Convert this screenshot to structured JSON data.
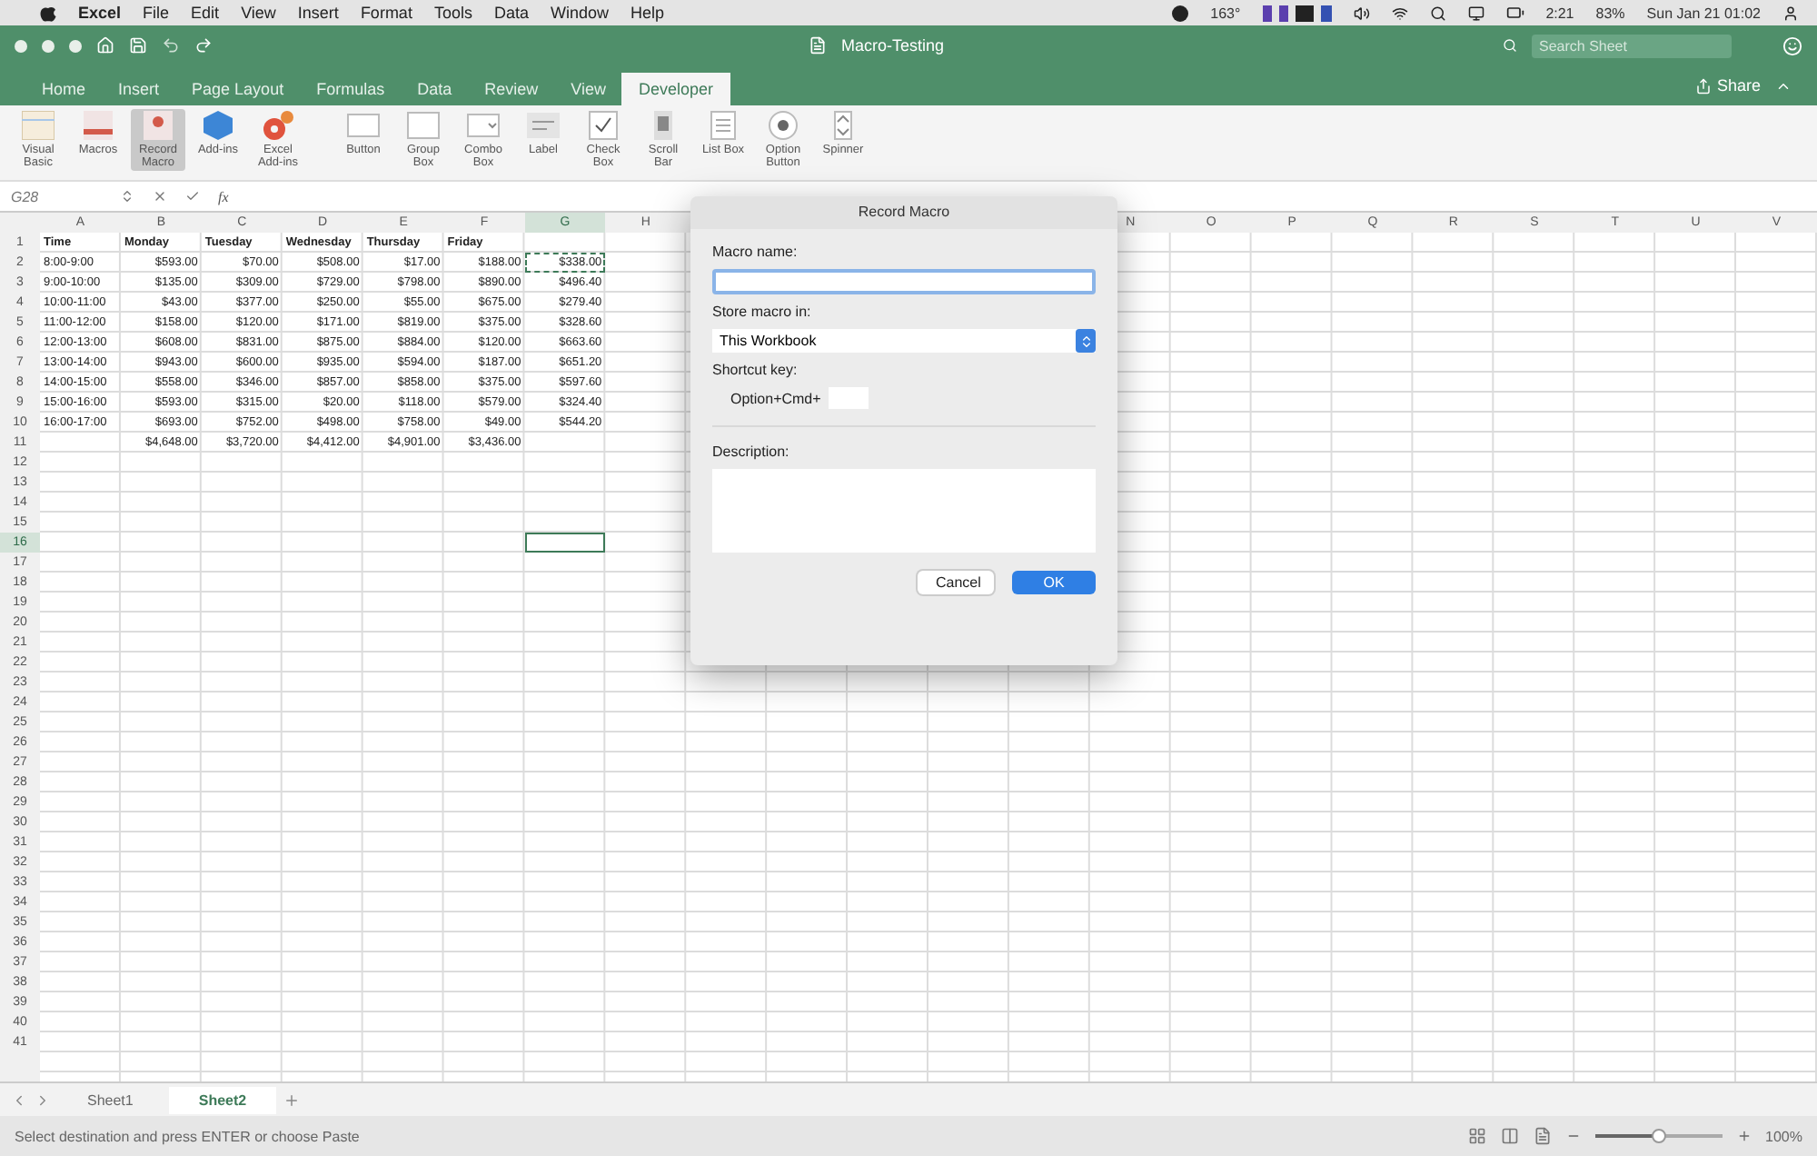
{
  "menu_bar": {
    "app": "Excel",
    "items": [
      "File",
      "Edit",
      "View",
      "Insert",
      "Format",
      "Tools",
      "Data",
      "Window",
      "Help"
    ],
    "status": {
      "temperature": "163°",
      "battery_time": "2:21",
      "battery_percent": "83%",
      "clock": "Sun Jan 21 01:02"
    }
  },
  "window": {
    "title": "Macro-Testing",
    "search": {
      "placeholder": "Search Sheet"
    },
    "share": "Share"
  },
  "tabs": [
    {
      "label": "Home",
      "selected": false
    },
    {
      "label": "Insert",
      "selected": false
    },
    {
      "label": "Page Layout",
      "selected": false
    },
    {
      "label": "Formulas",
      "selected": false
    },
    {
      "label": "Data",
      "selected": false
    },
    {
      "label": "Review",
      "selected": false
    },
    {
      "label": "View",
      "selected": false
    },
    {
      "label": "Developer",
      "selected": true
    }
  ],
  "ribbon": [
    {
      "label": "Visual Basic",
      "kind": "editor",
      "selected": false
    },
    {
      "label": "Macros",
      "kind": "macros",
      "selected": false
    },
    {
      "label": "Record Macro",
      "kind": "record",
      "selected": true
    },
    {
      "label": "Add-ins",
      "kind": "addins",
      "selected": false
    },
    {
      "label": "Excel Add-ins",
      "kind": "gears",
      "selected": false
    },
    {
      "label": "Button",
      "kind": "button",
      "selected": false
    },
    {
      "label": "Group Box",
      "kind": "groupbox",
      "selected": false
    },
    {
      "label": "Combo Box",
      "kind": "combo",
      "selected": false
    },
    {
      "label": "Label",
      "kind": "label",
      "selected": false
    },
    {
      "label": "Check Box",
      "kind": "check",
      "selected": false
    },
    {
      "label": "Scroll Bar",
      "kind": "scroll",
      "selected": false
    },
    {
      "label": "List Box",
      "kind": "list",
      "selected": false
    },
    {
      "label": "Option Button",
      "kind": "option",
      "selected": false
    },
    {
      "label": "Spinner",
      "kind": "spinner",
      "selected": false
    }
  ],
  "formula_bar": {
    "name_box": "G28",
    "fx": "fx"
  },
  "sheet": {
    "columns_left": [
      {
        "label": "A",
        "selected": false
      },
      {
        "label": "B",
        "selected": false
      },
      {
        "label": "C",
        "selected": false
      },
      {
        "label": "D",
        "selected": false
      },
      {
        "label": "E",
        "selected": false
      },
      {
        "label": "F",
        "selected": false
      },
      {
        "label": "G",
        "selected": true
      },
      {
        "label": "H",
        "selected": false
      }
    ],
    "columns_right": [
      {
        "label": "N",
        "selected": false
      },
      {
        "label": "O",
        "selected": false
      },
      {
        "label": "P",
        "selected": false
      },
      {
        "label": "Q",
        "selected": false
      },
      {
        "label": "R",
        "selected": false
      },
      {
        "label": "S",
        "selected": false
      },
      {
        "label": "T",
        "selected": false
      },
      {
        "label": "U",
        "selected": false
      },
      {
        "label": "V",
        "selected": false
      }
    ],
    "row_numbers": [
      {
        "label": "1",
        "selected": false
      },
      {
        "label": "2",
        "selected": false
      },
      {
        "label": "3",
        "selected": false
      },
      {
        "label": "4",
        "selected": false
      },
      {
        "label": "5",
        "selected": false
      },
      {
        "label": "6",
        "selected": false
      },
      {
        "label": "7",
        "selected": false
      },
      {
        "label": "8",
        "selected": false
      },
      {
        "label": "9",
        "selected": false
      },
      {
        "label": "10",
        "selected": false
      },
      {
        "label": "11",
        "selected": false
      },
      {
        "label": "12",
        "selected": false
      },
      {
        "label": "13",
        "selected": false
      },
      {
        "label": "14",
        "selected": false
      },
      {
        "label": "15",
        "selected": false
      },
      {
        "label": "16",
        "selected": true
      },
      {
        "label": "17",
        "selected": false
      },
      {
        "label": "18",
        "selected": false
      },
      {
        "label": "19",
        "selected": false
      },
      {
        "label": "20",
        "selected": false
      },
      {
        "label": "21",
        "selected": false
      },
      {
        "label": "22",
        "selected": false
      },
      {
        "label": "23",
        "selected": false
      },
      {
        "label": "24",
        "selected": false
      },
      {
        "label": "25",
        "selected": false
      },
      {
        "label": "26",
        "selected": false
      },
      {
        "label": "27",
        "selected": false
      },
      {
        "label": "28",
        "selected": false
      },
      {
        "label": "29",
        "selected": false
      },
      {
        "label": "30",
        "selected": false
      },
      {
        "label": "31",
        "selected": false
      },
      {
        "label": "32",
        "selected": false
      },
      {
        "label": "33",
        "selected": false
      },
      {
        "label": "34",
        "selected": false
      },
      {
        "label": "35",
        "selected": false
      },
      {
        "label": "36",
        "selected": false
      },
      {
        "label": "37",
        "selected": false
      },
      {
        "label": "38",
        "selected": false
      },
      {
        "label": "39",
        "selected": false
      },
      {
        "label": "40",
        "selected": false
      },
      {
        "label": "41",
        "selected": false
      }
    ],
    "rows": [
      [
        "Time",
        "Monday",
        "Tuesday",
        "Wednesday",
        "Thursday",
        "Friday"
      ],
      [
        "8:00-9:00",
        "$593.00",
        "$70.00",
        "$508.00",
        "$17.00",
        "$188.00",
        {
          "text": "$338.00",
          "copied": true
        }
      ],
      [
        "9:00-10:00",
        "$135.00",
        "$309.00",
        "$729.00",
        "$798.00",
        "$890.00",
        "$496.40"
      ],
      [
        "10:00-11:00",
        "$43.00",
        "$377.00",
        "$250.00",
        "$55.00",
        "$675.00",
        "$279.40"
      ],
      [
        "11:00-12:00",
        "$158.00",
        "$120.00",
        "$171.00",
        "$819.00",
        "$375.00",
        "$328.60"
      ],
      [
        "12:00-13:00",
        "$608.00",
        "$831.00",
        "$875.00",
        "$884.00",
        "$120.00",
        "$663.60"
      ],
      [
        "13:00-14:00",
        "$943.00",
        "$600.00",
        "$935.00",
        "$594.00",
        "$187.00",
        "$651.20"
      ],
      [
        "14:00-15:00",
        "$558.00",
        "$346.00",
        "$857.00",
        "$858.00",
        "$375.00",
        "$597.60"
      ],
      [
        "15:00-16:00",
        "$593.00",
        "$315.00",
        "$20.00",
        "$118.00",
        "$579.00",
        "$324.40"
      ],
      [
        "16:00-17:00",
        "$693.00",
        "$752.00",
        "$498.00",
        "$758.00",
        "$49.00",
        "$544.20"
      ],
      [
        null,
        "$4,648.00",
        "$3,720.00",
        "$4,412.00",
        "$4,901.00",
        "$3,436.00"
      ]
    ]
  },
  "dialog": {
    "title": "Record Macro",
    "name_label": "Macro name:",
    "store_label": "Store macro in:",
    "store_value": "This Workbook",
    "shortcut_label": "Shortcut key:",
    "shortcut_prefix": "Option+Cmd+",
    "description_label": "Description:",
    "buttons": [
      {
        "label": "Cancel",
        "kind": "secondary"
      },
      {
        "label": "OK",
        "kind": "primary"
      }
    ]
  },
  "sheet_tabs": [
    {
      "label": "Sheet1",
      "selected": false
    },
    {
      "label": "Sheet2",
      "selected": true
    }
  ],
  "status_bar": {
    "message": "Select destination and press ENTER or choose Paste",
    "zoom": {
      "level": 0.5,
      "reading": "100%"
    }
  }
}
